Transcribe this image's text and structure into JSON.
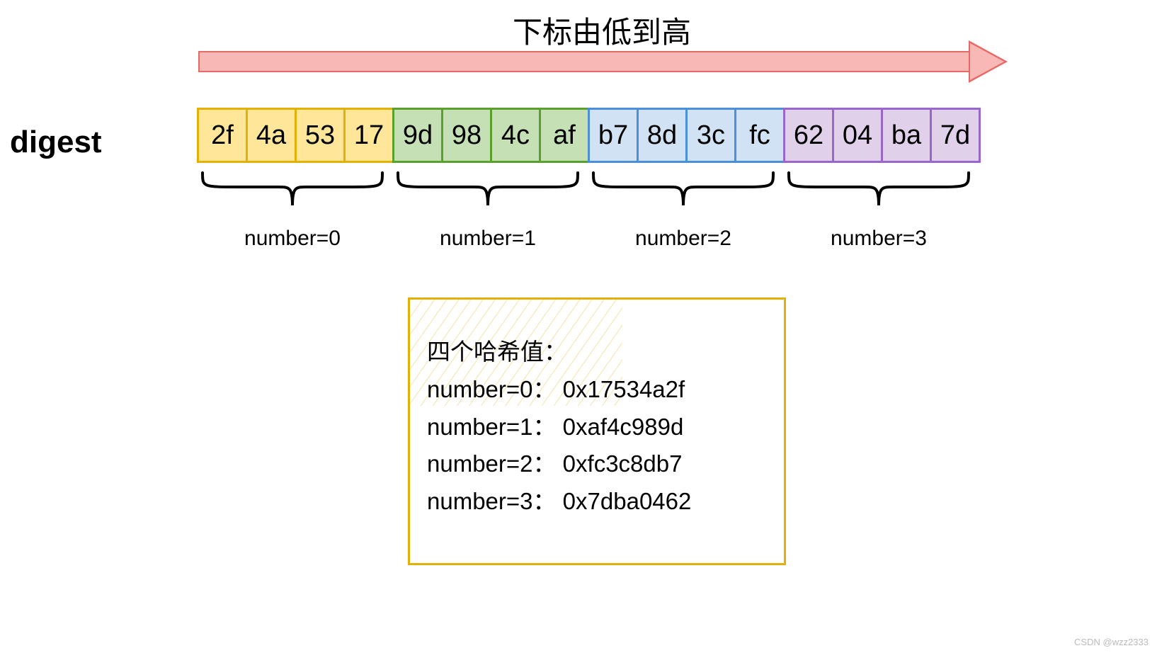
{
  "title": "下标由低到高",
  "digest_label": "digest",
  "groups": [
    {
      "bytes": [
        "2f",
        "4a",
        "53",
        "17"
      ],
      "label": "number=0",
      "color": "g0"
    },
    {
      "bytes": [
        "9d",
        "98",
        "4c",
        "af"
      ],
      "label": "number=1",
      "color": "g1"
    },
    {
      "bytes": [
        "b7",
        "8d",
        "3c",
        "fc"
      ],
      "label": "number=2",
      "color": "g2"
    },
    {
      "bytes": [
        "62",
        "04",
        "ba",
        "7d"
      ],
      "label": "number=3",
      "color": "g3"
    }
  ],
  "hashbox": {
    "title": "四个哈希值：",
    "lines": [
      "number=0： 0x17534a2f",
      "number=1： 0xaf4c989d",
      "number=2： 0xfc3c8db7",
      "number=3： 0x7dba0462"
    ]
  },
  "watermark": "CSDN @wzz2333",
  "colors": {
    "arrow_fill": "#f8b9b6",
    "arrow_stroke": "#e86a66",
    "box_stroke": "#e2b007"
  }
}
